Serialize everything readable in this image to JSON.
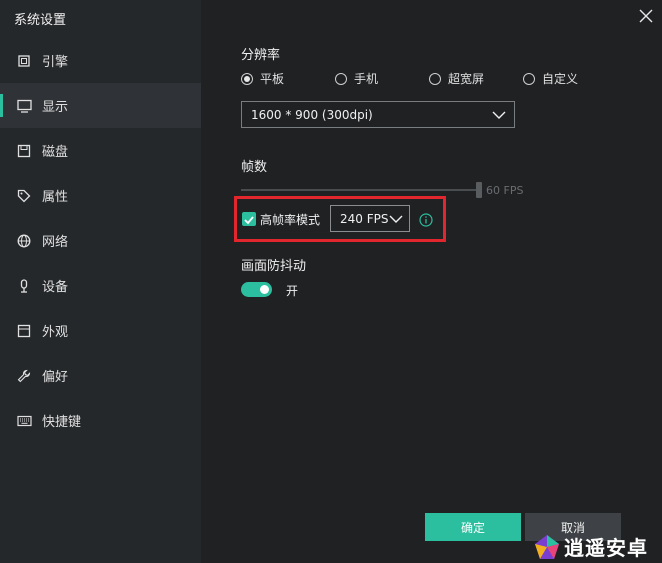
{
  "window": {
    "title": "系统设置"
  },
  "sidebar": {
    "items": [
      {
        "label": "引擎",
        "icon": "engine-chip-icon",
        "active": false
      },
      {
        "label": "显示",
        "icon": "monitor-icon",
        "active": true
      },
      {
        "label": "磁盘",
        "icon": "disk-save-icon",
        "active": false
      },
      {
        "label": "属性",
        "icon": "tag-icon",
        "active": false
      },
      {
        "label": "网络",
        "icon": "globe-icon",
        "active": false
      },
      {
        "label": "设备",
        "icon": "microphone-icon",
        "active": false
      },
      {
        "label": "外观",
        "icon": "window-layout-icon",
        "active": false
      },
      {
        "label": "偏好",
        "icon": "wrench-icon",
        "active": false
      },
      {
        "label": "快捷键",
        "icon": "keyboard-icon",
        "active": false
      }
    ]
  },
  "display": {
    "resolution_label": "分辨率",
    "modes": [
      {
        "label": "平板",
        "checked": true
      },
      {
        "label": "手机",
        "checked": false
      },
      {
        "label": "超宽屏",
        "checked": false
      },
      {
        "label": "自定义",
        "checked": false
      }
    ],
    "resolution_value": "1600 * 900 (300dpi)",
    "fps_label": "帧数",
    "fps_slider_value": "60 FPS",
    "high_fps_label": "高帧率模式",
    "high_fps_checked": true,
    "high_fps_value": "240 FPS",
    "stabilization_label": "画面防抖动",
    "stabilization_state": "开",
    "stabilization_on": true
  },
  "buttons": {
    "ok": "确定",
    "cancel": "取消"
  },
  "watermark": {
    "text": "逍遥安卓"
  },
  "colors": {
    "accent": "#2bbf9f",
    "highlight": "#e2262d",
    "sidebar_bg": "#25282b",
    "content_bg": "#1f2123"
  }
}
